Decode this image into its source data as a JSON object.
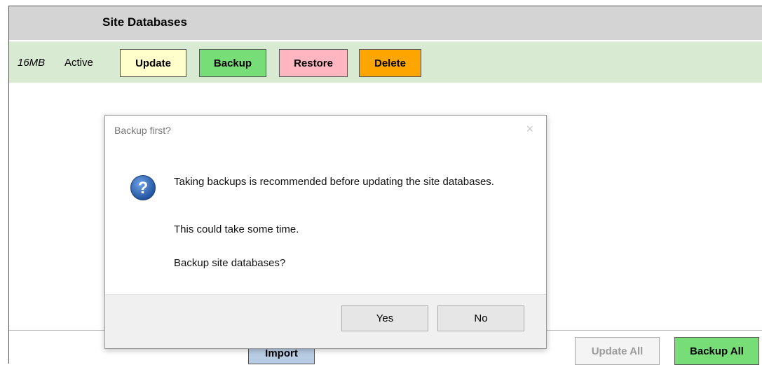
{
  "header": {
    "title": "Site Databases"
  },
  "db_row": {
    "size": "16MB",
    "status": "Active",
    "buttons": {
      "update": "Update",
      "backup": "Backup",
      "restore": "Restore",
      "delete": "Delete"
    }
  },
  "footer": {
    "import": "Import",
    "update_all": "Update All",
    "backup_all": "Backup All"
  },
  "dialog": {
    "title": "Backup first?",
    "close": "×",
    "icon": "question-icon",
    "message1": "Taking backups is recommended before updating the site databases.",
    "message2": "This could take some time.",
    "message3": "Backup site databases?",
    "yes": "Yes",
    "no": "No"
  },
  "colors": {
    "update": "#ffffcc",
    "backup": "#77dd77",
    "restore": "#ffb6c1",
    "delete": "#ffa500",
    "row_bg": "#d9ead3",
    "header_bg": "#d4d4d4",
    "import": "#b8cce4"
  }
}
